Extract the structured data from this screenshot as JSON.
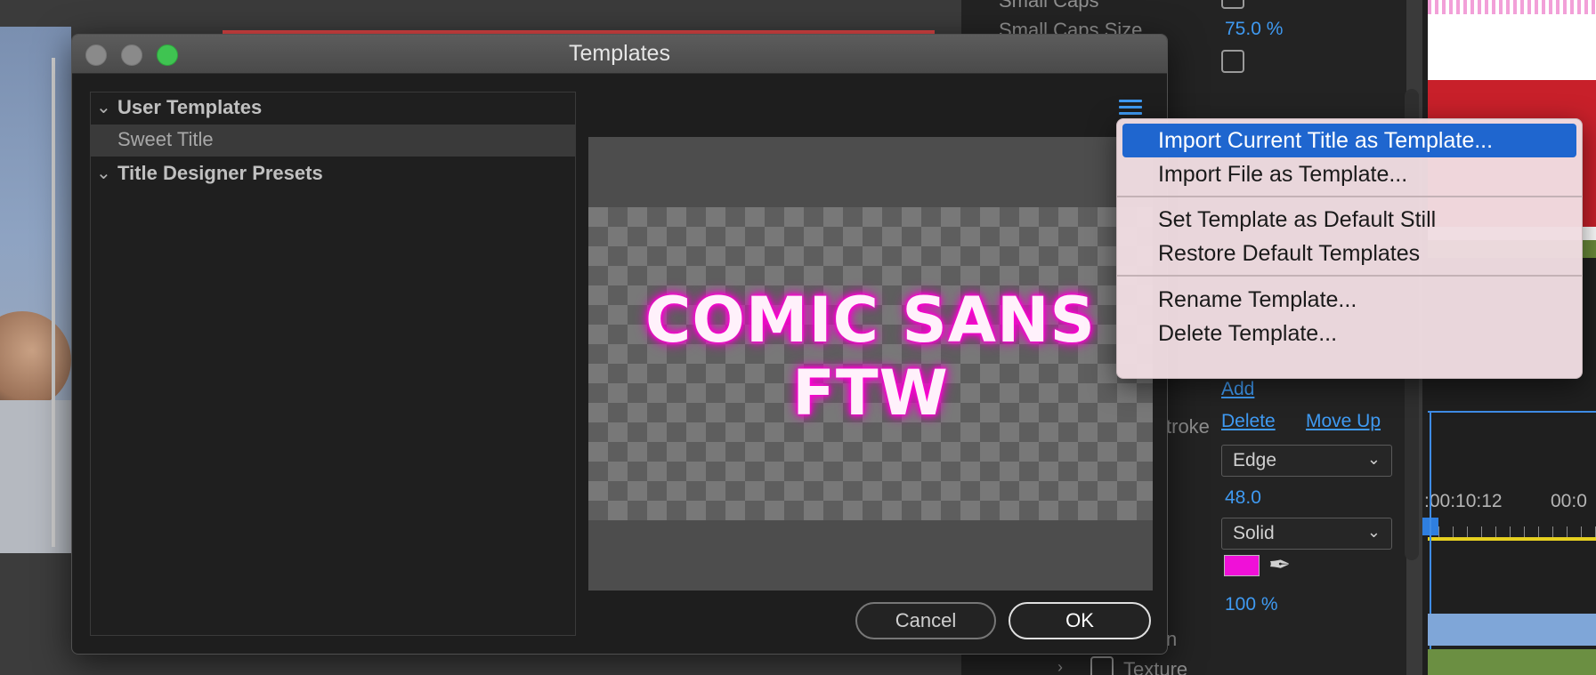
{
  "background": {
    "props": {
      "small_caps_label": "Small Caps",
      "small_caps_size_label": "Small Caps Size",
      "small_caps_size_value": "75.0 %",
      "stroke_label": "troke",
      "add_link": "Add",
      "delete_link": "Delete",
      "move_up_link": "Move Up",
      "stroke_type": "Edge",
      "stroke_size": "48.0",
      "fill_type": "Solid",
      "swatch_color": "#f010d8",
      "opacity": "100 %",
      "partial_label": "n",
      "texture_label": "Texture"
    },
    "timeline": {
      "timecode_1": ":00:10:12",
      "timecode_2": "00:0"
    }
  },
  "dialog": {
    "title": "Templates",
    "tree": [
      {
        "label": "User Templates",
        "expanded": true
      },
      {
        "label": "Sweet Title",
        "selected": true
      },
      {
        "label": "Title Designer Presets",
        "expanded": true
      }
    ],
    "preview": {
      "line1": "COMIC SANS",
      "line2": "FTW",
      "glow_color": "#ff00d4"
    },
    "cancel_label": "Cancel",
    "ok_label": "OK"
  },
  "menu": {
    "items": [
      "Import Current Title as Template...",
      "Import File as Template...",
      "Set Template as Default Still",
      "Restore Default Templates",
      "Rename Template...",
      "Delete Template..."
    ],
    "highlight_color": "#1f66cf"
  }
}
